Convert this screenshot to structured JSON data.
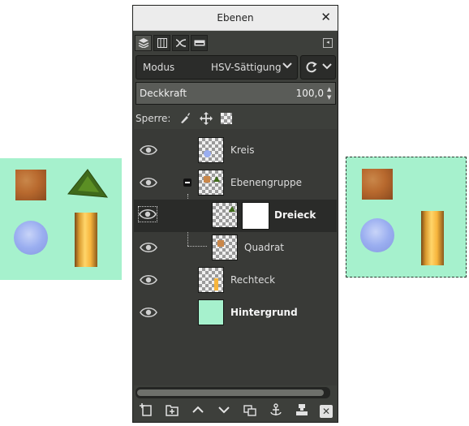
{
  "dialog": {
    "title": "Ebenen",
    "close": "✕",
    "tabs": [
      "layers-tab",
      "channels-tab",
      "paths-tab",
      "undo-history-tab"
    ],
    "mode": {
      "label": "Modus",
      "value": "HSV-Sättigung"
    },
    "opacity": {
      "label": "Deckkraft",
      "value": "100,0"
    },
    "lock": {
      "label": "Sperre:"
    },
    "layers": [
      {
        "name": "Kreis",
        "visible": true,
        "level": 0
      },
      {
        "name": "Ebenengruppe",
        "visible": true,
        "level": 0,
        "group": true,
        "expanded": true
      },
      {
        "name": "Dreieck",
        "visible": true,
        "level": 1,
        "selected": true,
        "has_mask": true
      },
      {
        "name": "Quadrat",
        "visible": true,
        "level": 1
      },
      {
        "name": "Rechteck",
        "visible": true,
        "level": 0
      },
      {
        "name": "Hintergrund",
        "visible": true,
        "level": 0,
        "bold": true
      }
    ],
    "bottom_tools": [
      "new-layer",
      "new-layer-group",
      "raise-layer",
      "lower-layer",
      "duplicate-layer",
      "anchor-layer",
      "mask-layer",
      "delete-layer"
    ]
  },
  "colors": {
    "canvas_bg": "#a6f1cd",
    "dialog_bg": "#3d3f3b"
  }
}
